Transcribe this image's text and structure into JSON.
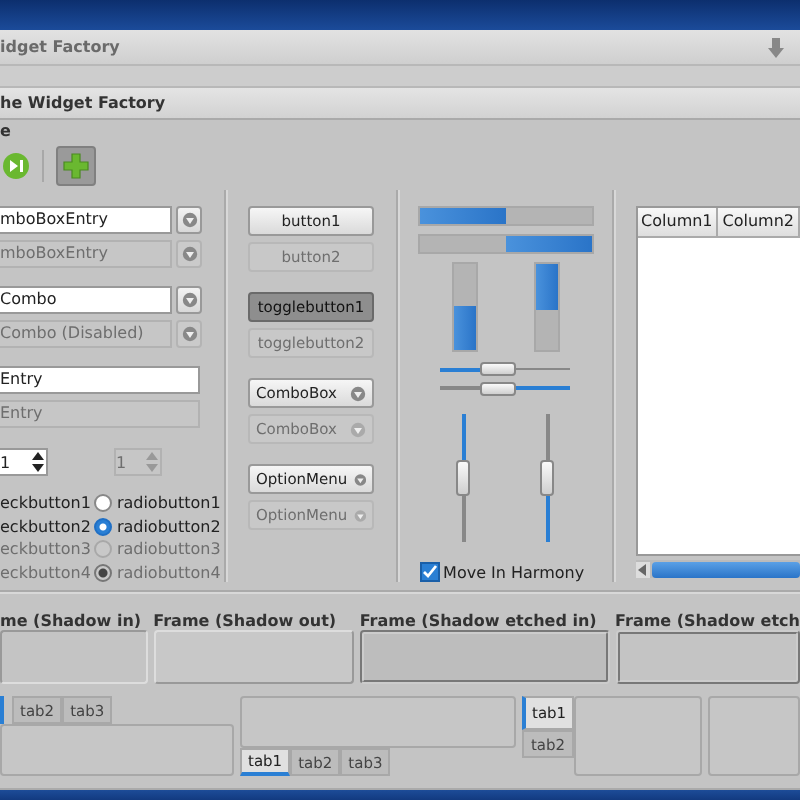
{
  "outer_window": {
    "title": "idget Factory"
  },
  "window": {
    "title": "he Widget Factory"
  },
  "menu": [
    "e"
  ],
  "toolbar": {
    "add_pressed": true
  },
  "entries": [
    {
      "kind": "combo-entry",
      "value": "mboBoxEntry",
      "disabled": false
    },
    {
      "kind": "combo-entry",
      "value": "mboBoxEntry",
      "disabled": true
    },
    {
      "kind": "combo",
      "value": "Combo",
      "disabled": false
    },
    {
      "kind": "combo",
      "value": "Combo (Disabled)",
      "disabled": true
    },
    {
      "kind": "entry",
      "value": "Entry",
      "disabled": false
    },
    {
      "kind": "entry",
      "value": "Entry",
      "disabled": true
    }
  ],
  "spin_buttons": [
    {
      "value": "1",
      "disabled": false
    },
    {
      "value": "1",
      "disabled": true
    }
  ],
  "check_buttons": [
    {
      "label": "eckbutton1",
      "disabled": false
    },
    {
      "label": "eckbutton2",
      "disabled": false
    },
    {
      "label": "eckbutton3",
      "disabled": true
    },
    {
      "label": "eckbutton4",
      "disabled": true
    }
  ],
  "radio_buttons": [
    {
      "label": "radiobutton1",
      "selected": false,
      "disabled": false
    },
    {
      "label": "radiobutton2",
      "selected": true,
      "disabled": false
    },
    {
      "label": "radiobutton3",
      "selected": false,
      "disabled": true
    },
    {
      "label": "radiobutton4",
      "selected": true,
      "disabled": true
    }
  ],
  "buttons": [
    {
      "kind": "button",
      "label": "button1",
      "disabled": false,
      "pressed": false
    },
    {
      "kind": "button",
      "label": "button2",
      "disabled": true,
      "pressed": false
    },
    {
      "kind": "toggle",
      "label": "togglebutton1",
      "disabled": false,
      "pressed": true
    },
    {
      "kind": "toggle",
      "label": "togglebutton2",
      "disabled": true,
      "pressed": false
    },
    {
      "kind": "combo",
      "label": "ComboBox",
      "disabled": false,
      "pressed": false
    },
    {
      "kind": "combo",
      "label": "ComboBox",
      "disabled": true,
      "pressed": false
    },
    {
      "kind": "option",
      "label": "OptionMenu",
      "disabled": false,
      "pressed": false
    },
    {
      "kind": "option",
      "label": "OptionMenu",
      "disabled": true,
      "pressed": false
    }
  ],
  "horizontal_progress_bars": [
    {
      "inverted": false,
      "level": 0.5
    },
    {
      "inverted": true,
      "level": 0.5
    }
  ],
  "vertical_progress_bars": [
    {
      "inverted": false,
      "level": 0.5
    },
    {
      "inverted": true,
      "level": 0.55
    }
  ],
  "horizontal_scales": [
    {
      "inverted": false,
      "level": 0.45
    },
    {
      "inverted": true,
      "level": 0.55
    }
  ],
  "vertical_scales": [
    {
      "inverted": false,
      "level": 0.5
    },
    {
      "inverted": true,
      "level": 0.5
    }
  ],
  "harmony": {
    "label": "Move In Harmony",
    "checked": true
  },
  "tree": {
    "columns": [
      "Column1",
      "Column2"
    ]
  },
  "frames": [
    {
      "label": "me (Shadow in)"
    },
    {
      "label": "Frame (Shadow out)"
    },
    {
      "label": "Frame (Shadow etched in)"
    },
    {
      "label": "Frame (Shadow etch"
    }
  ],
  "notebook_tabs_top": {
    "tabs": [
      {
        "label": "tab2",
        "selected": false
      },
      {
        "label": "tab3",
        "selected": false
      }
    ]
  },
  "notebook_tabs_bottom": {
    "tabs": [
      {
        "label": "tab1",
        "selected": true
      },
      {
        "label": "tab2",
        "selected": false
      },
      {
        "label": "tab3",
        "selected": false
      }
    ]
  },
  "notebook_tabs_left": {
    "tabs": [
      {
        "label": "tab1",
        "selected": true
      },
      {
        "label": "tab2",
        "selected": false
      }
    ]
  }
}
